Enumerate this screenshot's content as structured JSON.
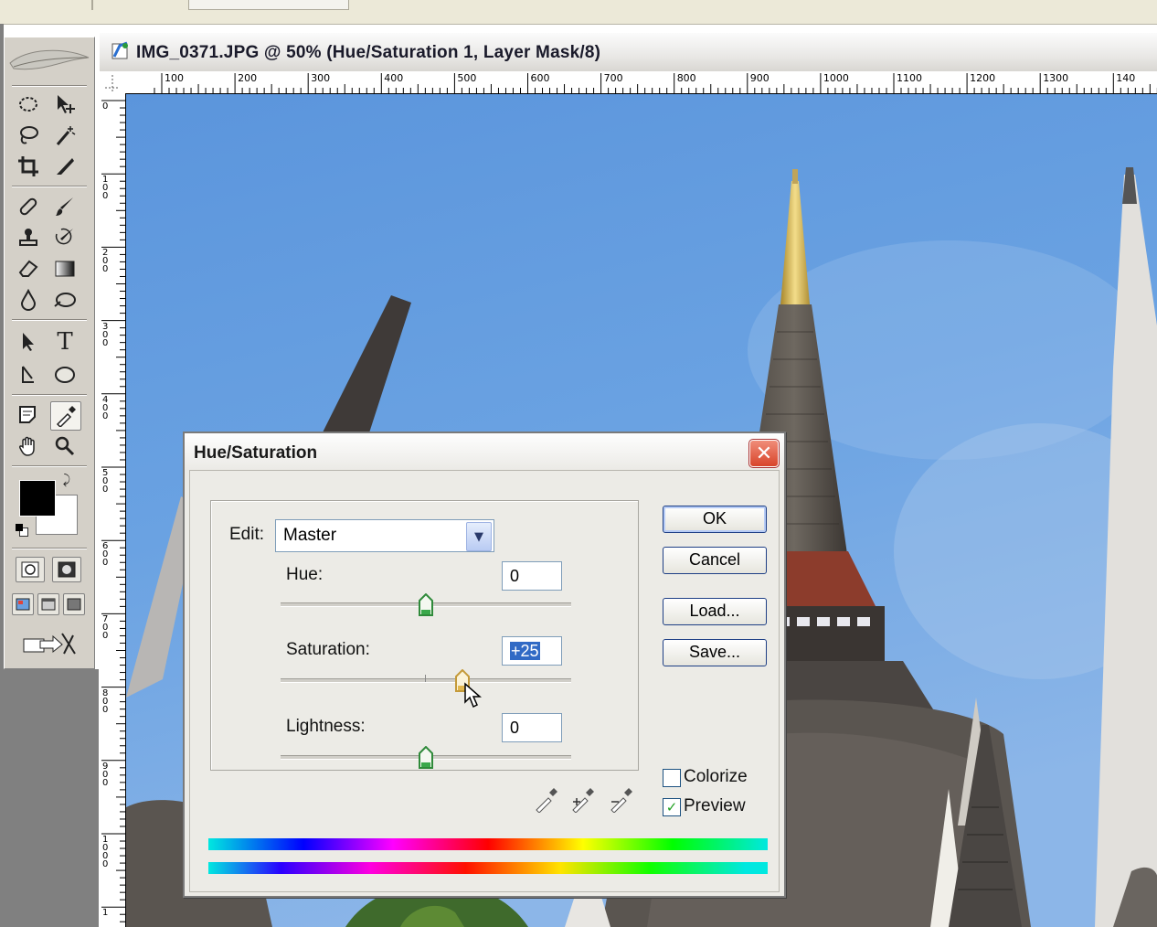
{
  "document": {
    "title": "IMG_0371.JPG @ 50% (Hue/Saturation 1, Layer Mask/8)",
    "ruler_h_labels": [
      "100",
      "200",
      "300",
      "400",
      "500",
      "600",
      "700",
      "800",
      "900",
      "1000",
      "1100",
      "1200",
      "1300",
      "140"
    ],
    "ruler_v_labels": [
      "0",
      "100",
      "200",
      "300",
      "400",
      "500",
      "600",
      "700",
      "800",
      "900",
      "1000",
      "1"
    ]
  },
  "toolbox": {
    "tools": [
      "marquee-icon",
      "move-icon",
      "lasso-icon",
      "magic-wand-icon",
      "crop-icon",
      "slice-icon",
      "healing-brush-icon",
      "brush-icon",
      "clone-stamp-icon",
      "history-brush-icon",
      "eraser-icon",
      "gradient-icon",
      "blur-icon",
      "dodge-icon",
      "path-selection-icon",
      "type-icon",
      "pen-icon",
      "ellipse-shape-icon",
      "notes-icon",
      "eyedropper-icon",
      "hand-icon",
      "zoom-icon"
    ],
    "type_tool_glyph": "T",
    "foreground_color": "#000000",
    "background_color": "#ffffff"
  },
  "dialog": {
    "title": "Hue/Saturation",
    "close_glyph": "✕",
    "edit_label": "Edit:",
    "edit_value": "Master",
    "hue_label": "Hue:",
    "hue_value": "0",
    "saturation_label": "Saturation:",
    "saturation_value": "+25",
    "lightness_label": "Lightness:",
    "lightness_value": "0",
    "hue_slider_fraction": 0.5,
    "saturation_slider_fraction": 0.625,
    "lightness_slider_fraction": 0.5,
    "buttons": {
      "ok": "OK",
      "cancel": "Cancel",
      "load": "Load...",
      "save": "Save..."
    },
    "colorize_label": "Colorize",
    "colorize_checked": false,
    "preview_label": "Preview",
    "preview_checked": true,
    "check_glyph": "✓"
  },
  "colors": {
    "sky": "#5a93d8",
    "title_bar_close": "#d8442a",
    "button_border": "#1e3f85"
  }
}
